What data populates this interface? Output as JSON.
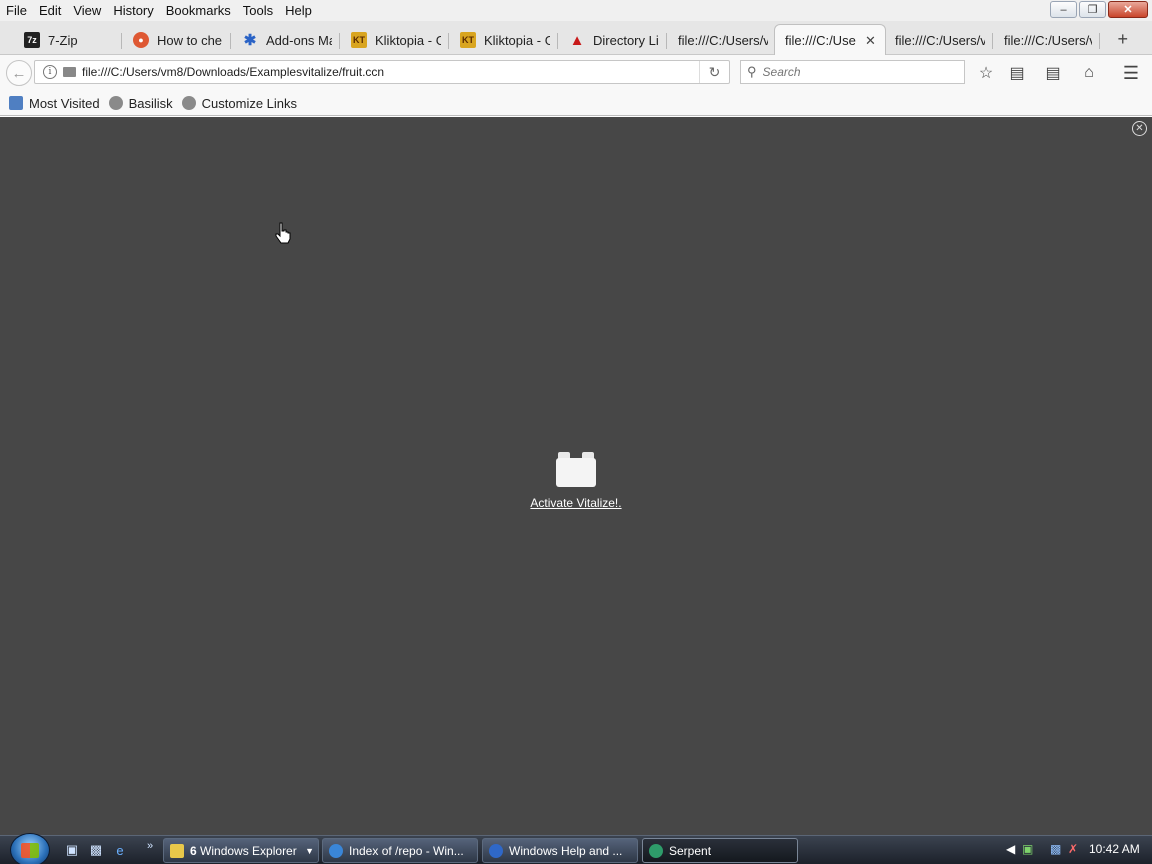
{
  "menu": [
    "File",
    "Edit",
    "View",
    "History",
    "Bookmarks",
    "Tools",
    "Help"
  ],
  "tabs": [
    {
      "title": "7-Zip",
      "favicon": "7z"
    },
    {
      "title": "How to che",
      "favicon": "duckduckgo"
    },
    {
      "title": "Add-ons Ma",
      "favicon": "puzzle"
    },
    {
      "title": "Kliktopia - G",
      "favicon": "KT"
    },
    {
      "title": "Kliktopia - G",
      "favicon": "KT"
    },
    {
      "title": "Directory Lis",
      "favicon": "red-bird"
    },
    {
      "title": "file:///C:/Users/v",
      "favicon": ""
    },
    {
      "title": "file:///C:/Use",
      "favicon": "",
      "active": true
    },
    {
      "title": "file:///C:/Users/v",
      "favicon": ""
    },
    {
      "title": "file:///C:/Users/v",
      "favicon": ""
    }
  ],
  "nav": {
    "url": "file:///C:/Users/vm8/Downloads/Examplesvitalize/fruit.ccn",
    "search_placeholder": "Search"
  },
  "bookmarks": [
    "Most Visited",
    "Basilisk",
    "Customize Links"
  ],
  "content": {
    "activate_link": "Activate Vitalize!."
  },
  "taskbar": {
    "tasks": [
      {
        "count": "6",
        "label": "Windows Explorer"
      },
      {
        "label": "Index of /repo - Win..."
      },
      {
        "label": "Windows Help and ..."
      },
      {
        "label": "Serpent"
      }
    ],
    "clock": "10:42 AM"
  },
  "colors": {
    "content_bg": "#474747",
    "link": "#ffffff"
  }
}
